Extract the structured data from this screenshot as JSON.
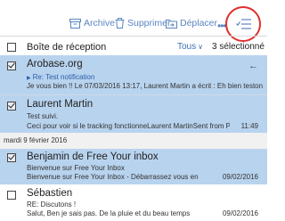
{
  "toolbar": {
    "archive_label": "Archive",
    "delete_label": "Supprimer",
    "move_label": "Déplacer",
    "more_label": "•••"
  },
  "inbox": {
    "title": "Boîte de réception",
    "filter_label": "Tous",
    "selected_count": "3 sélectionné"
  },
  "messages": [
    {
      "sender": "Arobase.org",
      "subject": "Re: Test notification",
      "preview": "Je vous bien !! Le 07/03/2016 13:17, Laurent Martin a écrit : Eh bien testons,",
      "time": "",
      "selected": true
    },
    {
      "sender": "Laurent Martin",
      "subject": "Test suivi.",
      "preview": "Ceci pour voir si le tracking fonctionneLaurent MartinSent from Polymail",
      "time": "11:49",
      "selected": true
    },
    {
      "sender": "Benjamin de Free Your inbox",
      "subject": "Bienvenue sur Free Your Inbox",
      "preview": "Bienvenue sur Free Your Inbox - Débarrassez vous en",
      "time": "09/02/2016",
      "selected": true
    },
    {
      "sender": "Sébastien",
      "subject": "RE: Discutons !",
      "preview": "Salut, Ben je sais pas. De la pluie et du beau temps",
      "time": "09/02/2016",
      "selected": false
    }
  ],
  "date_separator": "mardi 9 février 2016",
  "colors": {
    "accent": "#5a86c3",
    "selected_row": "#b8d3ee",
    "highlight_ring": "#e02f2f"
  }
}
